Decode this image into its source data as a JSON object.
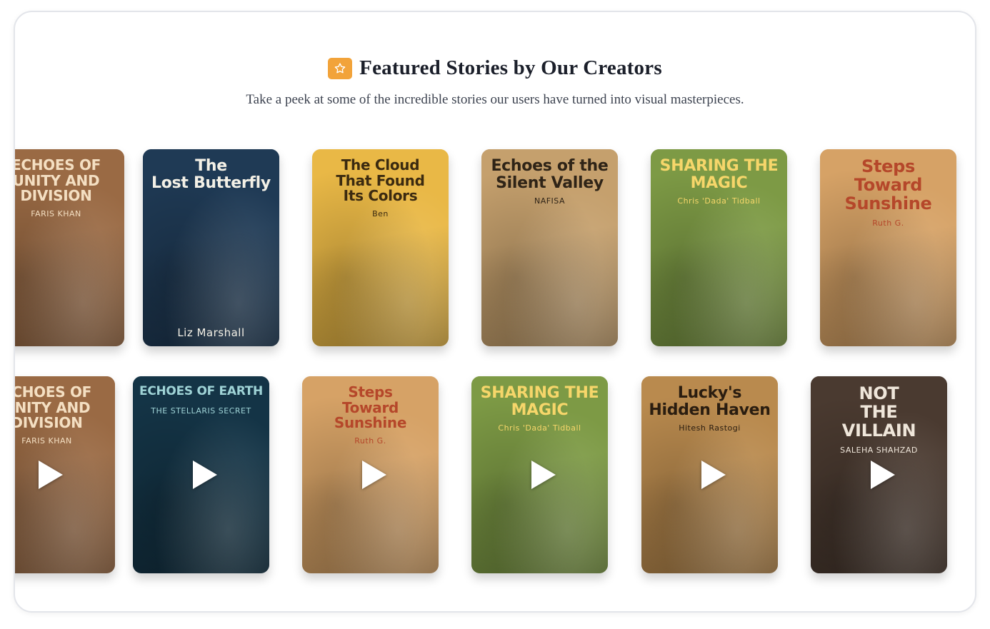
{
  "section": {
    "title": "Featured Stories by Our Creators",
    "subtitle": "Take a peek at some of the incredible stories our users have turned into visual masterpieces.",
    "icon": "star-icon"
  },
  "row1": [
    {
      "title": "ECHOES OF\nUNITY AND\nDIVISION",
      "author": "FARIS KHAN",
      "bg": "#9a6a44",
      "fg": "#f4dfc2",
      "auth_fg": "#f4dfc2"
    },
    {
      "title": "The\nLost Butterfly",
      "author": "Liz Marshall",
      "bg": "#1f3a55",
      "fg": "#f3f0e6",
      "auth_fg": "#f3f0e6"
    },
    {
      "title": "The Cloud\nThat Found\nIts Colors",
      "author": "Ben",
      "bg": "#e9b846",
      "fg": "#3b2a10",
      "auth_fg": "#3b2a10"
    },
    {
      "title": "Echoes of the\nSilent Valley",
      "author": "NAFISA",
      "bg": "#c5a06d",
      "fg": "#2f2417",
      "auth_fg": "#2f2417"
    },
    {
      "title": "SHARING THE\nMAGIC",
      "author": "Chris 'Dada' Tidball",
      "bg": "#7d9a45",
      "fg": "#f6d66a",
      "auth_fg": "#f6d66a"
    },
    {
      "title": "Steps\nToward\nSunshine",
      "author": "Ruth G.",
      "bg": "#d6a266",
      "fg": "#b5472a",
      "auth_fg": "#b5472a"
    }
  ],
  "row2": [
    {
      "title": "ECHOES OF\nUNITY AND\nDIVISION",
      "author": "FARIS KHAN",
      "bg": "#9a6a44",
      "fg": "#f4dfc2",
      "auth_fg": "#f4dfc2"
    },
    {
      "title": "ECHOES OF EARTH",
      "author": "THE STELLARIS SECRET",
      "bg": "#143446",
      "fg": "#9fd3d6",
      "auth_fg": "#9fd3d6"
    },
    {
      "title": "Steps\nToward\nSunshine",
      "author": "Ruth G.",
      "bg": "#d6a266",
      "fg": "#b5472a",
      "auth_fg": "#b5472a"
    },
    {
      "title": "SHARING THE\nMAGIC",
      "author": "Chris 'Dada' Tidball",
      "bg": "#7d9a45",
      "fg": "#f6d66a",
      "auth_fg": "#f6d66a"
    },
    {
      "title": "Lucky's\nHidden Haven",
      "author": "Hitesh Rastogi",
      "bg": "#b98a4e",
      "fg": "#2a1d10",
      "auth_fg": "#2a1d10"
    },
    {
      "title": "NOT\nTHE\nVILLAIN",
      "author": "SALEHA SHAHZAD",
      "bg": "#4a3a30",
      "fg": "#efe6da",
      "auth_fg": "#efe6da"
    }
  ]
}
